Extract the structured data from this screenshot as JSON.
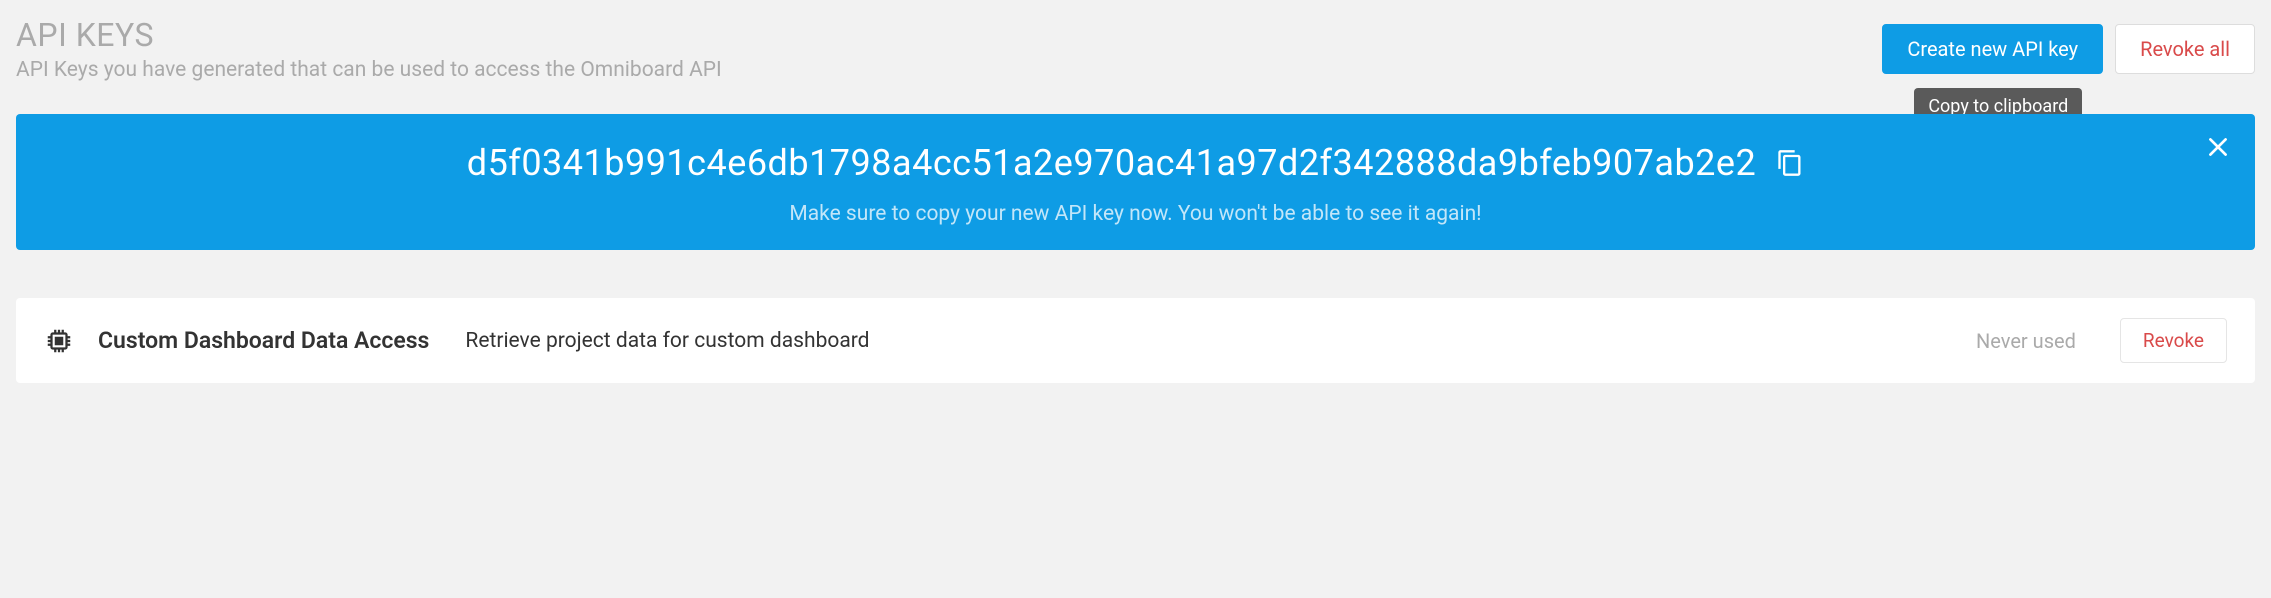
{
  "header": {
    "title": "API KEYS",
    "subtitle": "API Keys you have generated that can be used to access the Omniboard API",
    "create_label": "Create new API key",
    "revoke_all_label": "Revoke all"
  },
  "tooltip": {
    "copy_label": "Copy to clipboard"
  },
  "alert": {
    "api_key": "d5f0341b991c4e6db1798a4cc51a2e970ac41a97d2f342888da9bfeb907ab2e2",
    "subtext": "Make sure to copy your new API key now. You won't be able to see it again!"
  },
  "keys": [
    {
      "name": "Custom Dashboard Data Access",
      "description": "Retrieve project data for custom dashboard",
      "status": "Never used",
      "revoke_label": "Revoke"
    }
  ]
}
